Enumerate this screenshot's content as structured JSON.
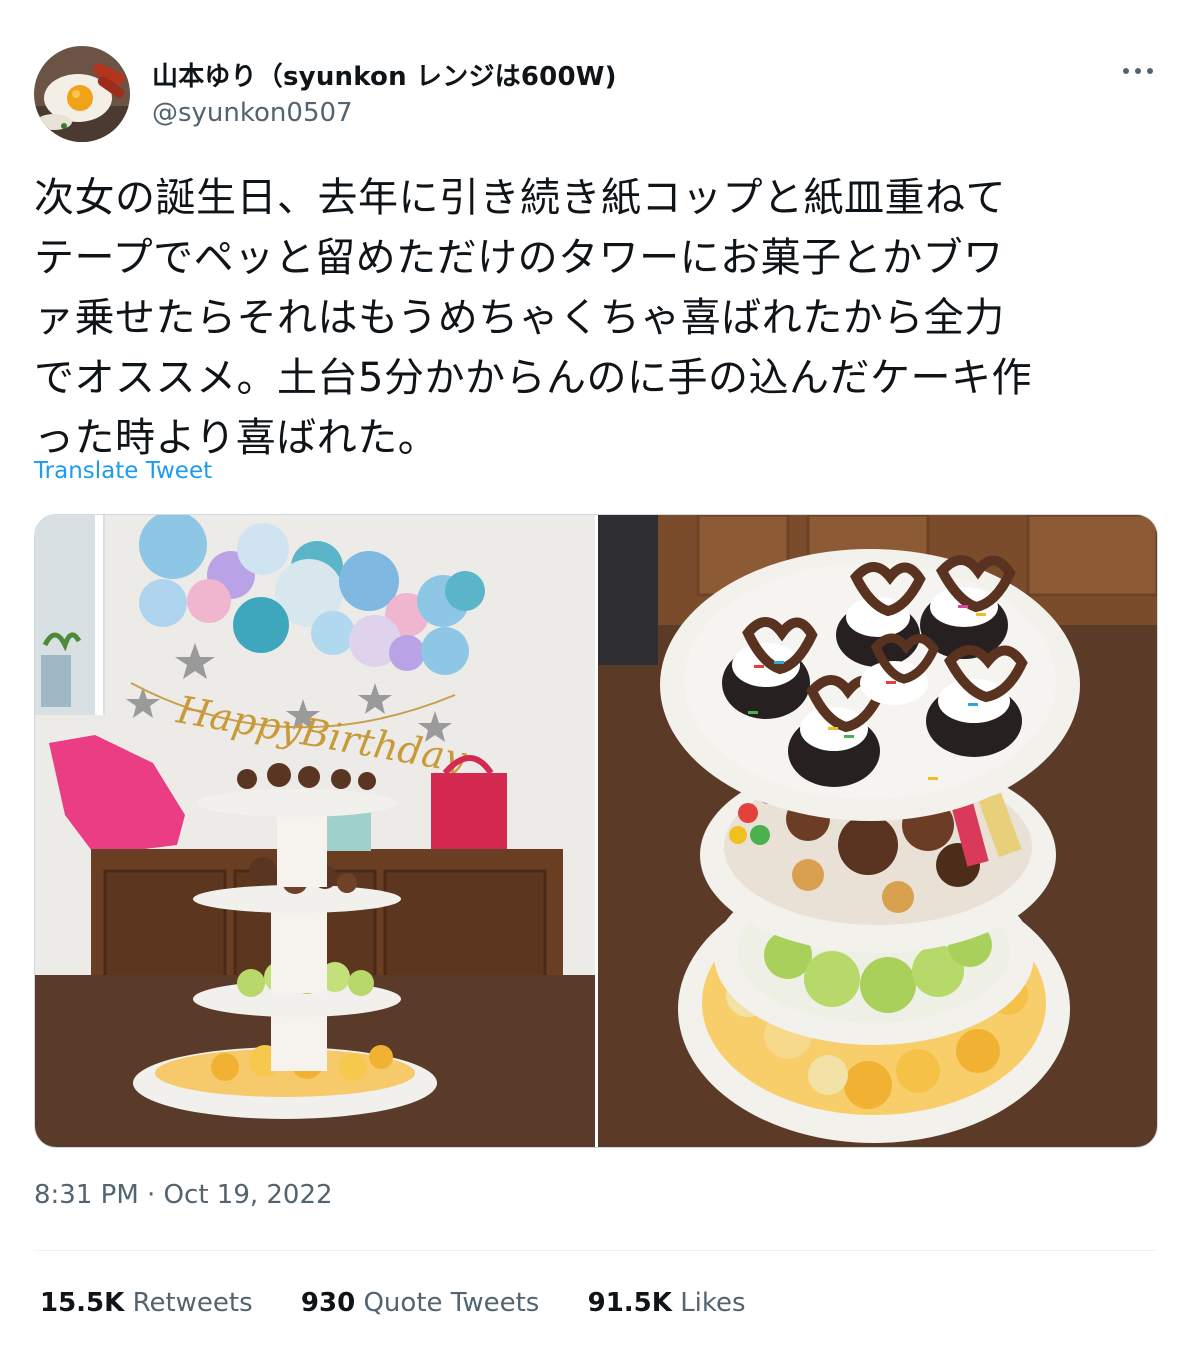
{
  "user": {
    "display_name": "山本ゆり（syunkon レンジは600W)",
    "handle": "@syunkon0507"
  },
  "tweet": {
    "text": "次女の誕生日、去年に引き続き紙コップと紙皿重ねて\nテープでペッと留めただけのタワーにお菓子とかブワ\nァ乗せたらそれはもうめちゃくちゃ喜ばれたから全力\nでオススメ。土台5分かからんのに手の込んだケーキ作\nった時より喜ばれた。",
    "translate_label": "Translate Tweet",
    "timestamp": "8:31 PM · Oct 19, 2022"
  },
  "stats": {
    "retweets": {
      "count": "15.5K",
      "label": "Retweets"
    },
    "quotes": {
      "count": "930",
      "label": "Quote Tweets"
    },
    "likes": {
      "count": "91.5K",
      "label": "Likes"
    }
  },
  "media": {
    "left_photo_banner": "HappyBirthday"
  },
  "colors": {
    "link": "#1d9bf0",
    "secondary_text": "#536471",
    "primary_text": "#0f1419",
    "divider": "#eff3f4"
  },
  "icons": [
    "more-horizontal-icon"
  ]
}
